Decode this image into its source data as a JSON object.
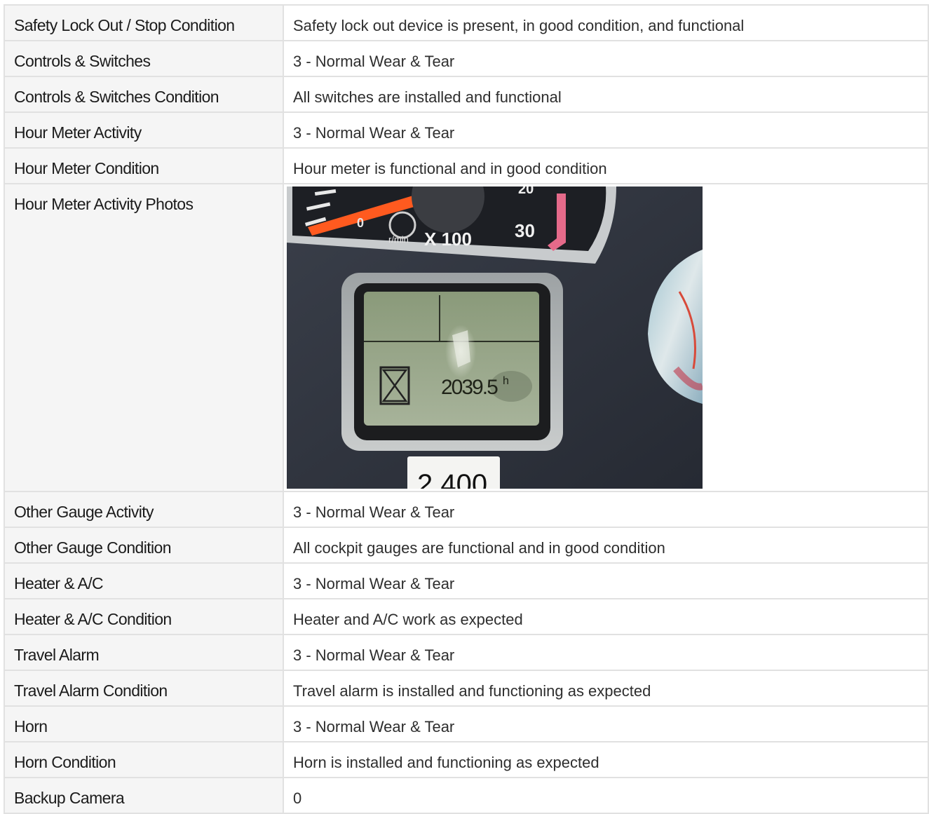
{
  "rows": [
    {
      "label": "Safety Lock Out / Stop Condition",
      "value": "Safety lock out device is present, in good condition, and functional"
    },
    {
      "label": "Controls & Switches",
      "value": "3 - Normal Wear & Tear"
    },
    {
      "label": "Controls & Switches Condition",
      "value": "All switches are installed and functional"
    },
    {
      "label": "Hour Meter Activity",
      "value": "3 - Normal Wear & Tear"
    },
    {
      "label": "Hour Meter Condition",
      "value": "Hour meter is functional and in good condition"
    }
  ],
  "photo_row": {
    "label": "Hour Meter Activity Photos",
    "photo": {
      "gauge_unit": "r/min X 100",
      "gauge_tick_30": "30",
      "gauge_tick_20": "20",
      "gauge_tick_0": "0",
      "hour_reading": "2039.5",
      "hour_suffix": "h",
      "sticker_text": "2,400"
    }
  },
  "rows2": [
    {
      "label": "Other Gauge Activity",
      "value": "3 - Normal Wear & Tear"
    },
    {
      "label": "Other Gauge Condition",
      "value": "All cockpit gauges are functional and in good condition"
    },
    {
      "label": "Heater & A/C",
      "value": "3 - Normal Wear & Tear"
    },
    {
      "label": "Heater & A/C Condition",
      "value": "Heater and A/C work as expected"
    },
    {
      "label": "Travel Alarm",
      "value": "3 - Normal Wear & Tear"
    },
    {
      "label": "Travel Alarm Condition",
      "value": "Travel alarm is installed and functioning as expected"
    },
    {
      "label": "Horn",
      "value": "3 - Normal Wear & Tear"
    },
    {
      "label": "Horn Condition",
      "value": "Horn is installed and functioning as expected"
    },
    {
      "label": "Backup Camera",
      "value": "0"
    }
  ]
}
